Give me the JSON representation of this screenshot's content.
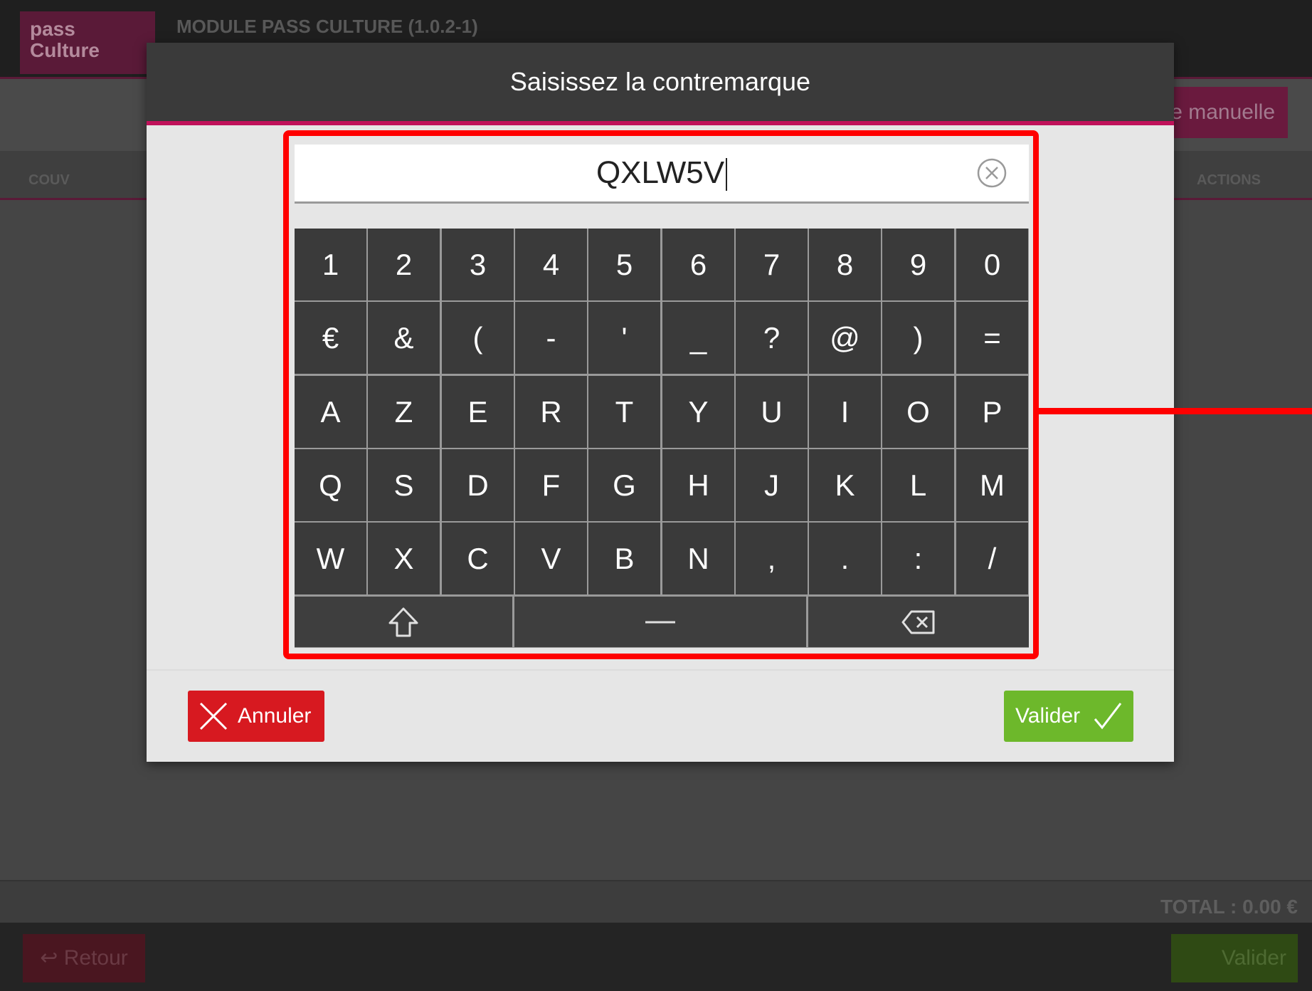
{
  "app": {
    "logo_line1": "pass",
    "logo_line2": "Culture",
    "module_title": "MODULE PASS CULTURE (1.0.2-1)",
    "manual_button": "e manuelle",
    "col_couv": "COUV",
    "col_actions": "ACTIONS",
    "total": "TOTAL : 0.00 €",
    "back_label": "Retour",
    "validate_label": "Valider"
  },
  "modal": {
    "title": "Saisissez la contremarque",
    "input_value": "QXLW5V",
    "cancel_label": "Annuler",
    "validate_label": "Valider"
  },
  "keyboard": {
    "rows": [
      [
        "1",
        "2",
        "3",
        "4",
        "5",
        "6",
        "7",
        "8",
        "9",
        "0"
      ],
      [
        "€",
        "&",
        "(",
        "-",
        "'",
        "_",
        "?",
        "@",
        ")",
        "="
      ],
      [
        "A",
        "Z",
        "E",
        "R",
        "T",
        "Y",
        "U",
        "I",
        "O",
        "P"
      ],
      [
        "Q",
        "S",
        "D",
        "F",
        "G",
        "H",
        "J",
        "K",
        "L",
        "M"
      ],
      [
        "W",
        "X",
        "C",
        "V",
        "B",
        "N",
        ",",
        ".",
        ":",
        "/"
      ]
    ],
    "bottom_keys": [
      "shift-icon",
      "space-bar",
      "backspace-icon"
    ]
  },
  "colors": {
    "accent": "#c0125a",
    "cancel": "#d71920",
    "validate": "#6db82b",
    "highlight": "#ff0000"
  }
}
